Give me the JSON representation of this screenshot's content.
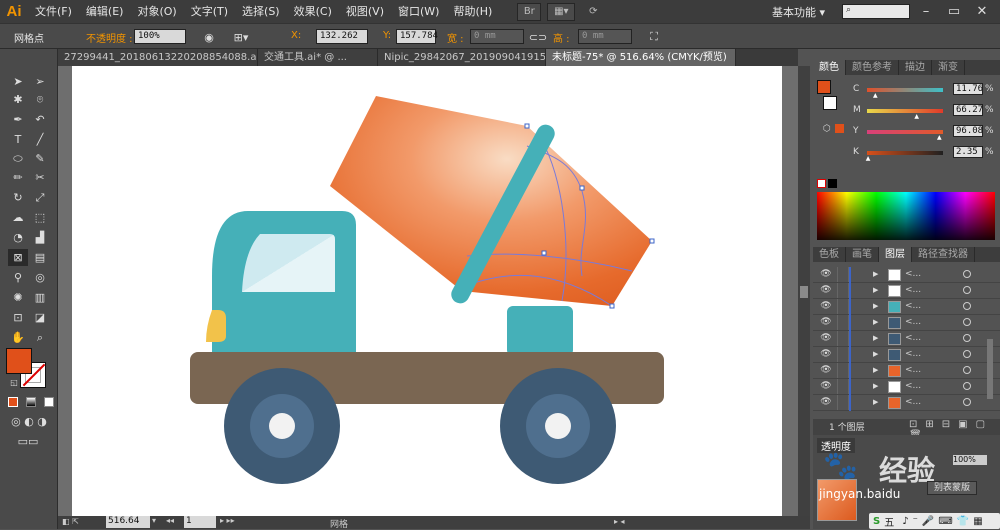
{
  "app": {
    "logo": "Ai"
  },
  "menu": [
    "文件(F)",
    "编辑(E)",
    "对象(O)",
    "文字(T)",
    "选择(S)",
    "效果(C)",
    "视图(V)",
    "窗口(W)",
    "帮助(H)"
  ],
  "workspace": {
    "label": "基本功能",
    "arrow": "▾"
  },
  "control": {
    "selection_label": "网格点",
    "opacity_label": "不透明度 :",
    "opacity_value": "100%",
    "x_label": "X:",
    "x_value": "132.262",
    "y_label": "Y:",
    "y_value": "157.784",
    "w_label": "宽 :",
    "w_value": "0 mm",
    "h_label": "高 :",
    "h_value": "0 mm"
  },
  "doc_tabs": [
    {
      "label": "27299441_20180613220208854088.ai* @ ...",
      "active": false
    },
    {
      "label": "交通工具.ai* @ ...",
      "active": false
    },
    {
      "label": "Nipic_29842067_20190904191531162000.ai*",
      "active": false
    },
    {
      "label": "未标题-75* @ 516.64% (CMYK/预览)",
      "active": true
    }
  ],
  "color_panel": {
    "tabs": [
      "颜色",
      "颜色参考",
      "描边",
      "渐变"
    ],
    "channels": [
      {
        "label": "C",
        "value": "11.76",
        "fraction": 0.1176,
        "gradient": "linear-gradient(to right,#e0502a,#3ec0c8)"
      },
      {
        "label": "M",
        "value": "66.27",
        "fraction": 0.6627,
        "gradient": "linear-gradient(to right,#e8d84a,#e03a2a)"
      },
      {
        "label": "Y",
        "value": "96.08",
        "fraction": 0.9608,
        "gradient": "linear-gradient(to right,#d8407a,#e05a2a)"
      },
      {
        "label": "K",
        "value": "2.35",
        "fraction": 0.0235,
        "gradient": "linear-gradient(to right,#d8501a,#202020)"
      }
    ],
    "pct": "%"
  },
  "layers_panel": {
    "tabs": [
      "色板",
      "画笔",
      "图层",
      "路径查找器"
    ],
    "rows": [
      {
        "thumb": "#ffffff",
        "name": "<..."
      },
      {
        "thumb": "#ffffff",
        "name": "<..."
      },
      {
        "thumb": "#45b0b8",
        "name": "<..."
      },
      {
        "thumb": "#3e5a74",
        "name": "<..."
      },
      {
        "thumb": "#3e5a74",
        "name": "<..."
      },
      {
        "thumb": "#3e5a74",
        "name": "<..."
      },
      {
        "thumb": "#e8642a",
        "name": "<..."
      },
      {
        "thumb": "#ffffff",
        "name": "<..."
      },
      {
        "thumb": "#e8642a",
        "name": "<..."
      }
    ],
    "footer": "1 个图层"
  },
  "status": {
    "zoom": "516.64",
    "page": "1",
    "mode": "网格"
  },
  "colors": {
    "fill": "#e0501a",
    "accent": "#f29400"
  },
  "watermark": {
    "text": "经验",
    "site": "jingyan.baidu",
    "button": "别表蒙版"
  },
  "ime": {
    "label": "五"
  }
}
